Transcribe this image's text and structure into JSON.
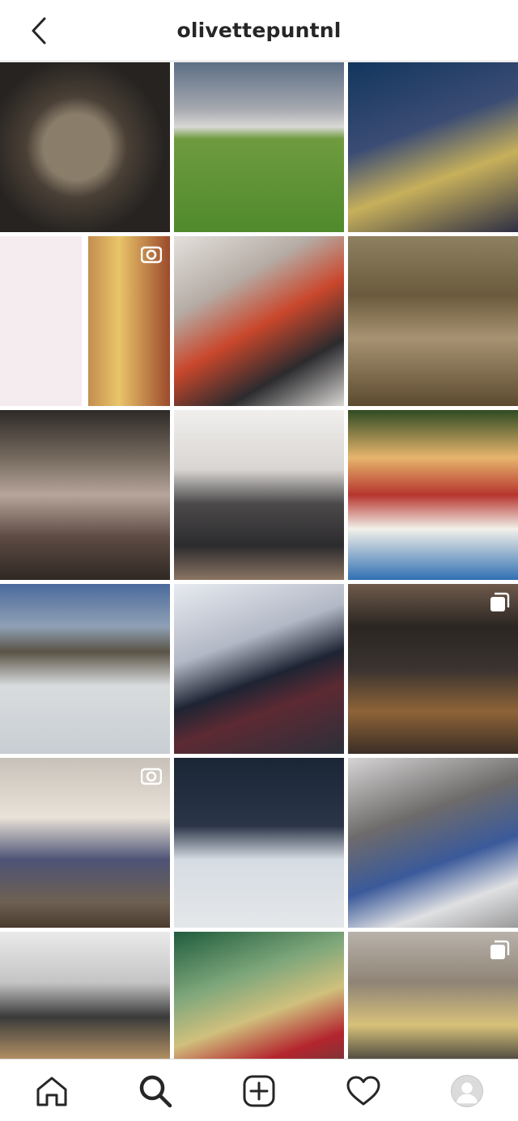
{
  "header": {
    "title": "olivettepuntnl",
    "back_icon": "chevron-left-icon"
  },
  "grid": {
    "tiles": [
      {
        "name": "post-cat-closeup",
        "badge": null
      },
      {
        "name": "post-garden-picnic-table",
        "badge": null
      },
      {
        "name": "post-kids-on-sofa",
        "badge": null
      },
      {
        "name": "post-crafts-and-candy",
        "badge": "video-icon"
      },
      {
        "name": "post-mirror-selfie",
        "badge": null
      },
      {
        "name": "post-kids-in-woods",
        "badge": null
      },
      {
        "name": "post-elevator-mirror",
        "badge": null
      },
      {
        "name": "post-boy-on-beanbag",
        "badge": null
      },
      {
        "name": "post-boy-with-book",
        "badge": null
      },
      {
        "name": "post-family-on-ice",
        "badge": null
      },
      {
        "name": "post-car-window-snow",
        "badge": null
      },
      {
        "name": "post-gift-box",
        "badge": "carousel-icon"
      },
      {
        "name": "post-boy-on-floor",
        "badge": "video-icon"
      },
      {
        "name": "post-snowman-by-car",
        "badge": null
      },
      {
        "name": "post-driving-peace-sign",
        "badge": null
      },
      {
        "name": "post-boy-costume",
        "badge": null
      },
      {
        "name": "post-girl-peacock",
        "badge": null
      },
      {
        "name": "post-kitchen-blender",
        "badge": "carousel-icon"
      },
      {
        "name": "post-partial-1",
        "badge": null
      },
      {
        "name": "post-partial-2",
        "badge": null
      },
      {
        "name": "post-partial-3",
        "badge": null
      }
    ]
  },
  "tabbar": {
    "items": [
      {
        "name": "home-tab",
        "icon": "home-icon"
      },
      {
        "name": "search-tab",
        "icon": "search-icon",
        "active": true
      },
      {
        "name": "new-post-tab",
        "icon": "plus-square-icon"
      },
      {
        "name": "activity-tab",
        "icon": "heart-icon"
      },
      {
        "name": "profile-tab",
        "icon": "avatar-icon"
      }
    ]
  },
  "colors": {
    "text": "#262626",
    "divider": "#dbdbdb",
    "background": "#ffffff"
  }
}
